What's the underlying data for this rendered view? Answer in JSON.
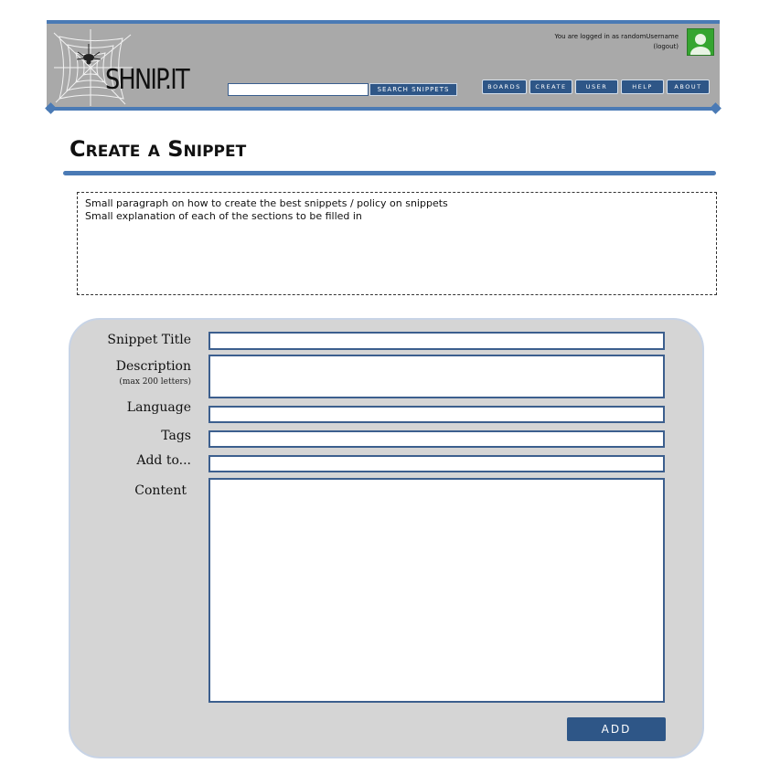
{
  "header": {
    "logo_text": "SHNIP.IT",
    "search_button": "Search Snippets",
    "nav": [
      "Boards",
      "Create",
      "User",
      "Help",
      "About"
    ],
    "login_status_line1": "You are logged in as randomUsername",
    "login_status_line2": "(logout)"
  },
  "page": {
    "title": "Create a Snippet",
    "info_line1": "Small paragraph on how to create the best snippets / policy on snippets",
    "info_line2": "Small explanation of each of the sections to be filled in"
  },
  "form": {
    "title_label": "Snippet Title",
    "description_label": "Description",
    "description_hint": "(max 200 letters)",
    "language_label": "Language",
    "tags_label": "Tags",
    "addto_label": "Add to...",
    "content_label": "Content",
    "submit_label": "ADD"
  },
  "colors": {
    "accent": "#4a7ab5",
    "button": "#2e5687",
    "header_bg": "#a9a9a9",
    "panel_bg": "#d5d5d5",
    "avatar": "#35a530"
  }
}
